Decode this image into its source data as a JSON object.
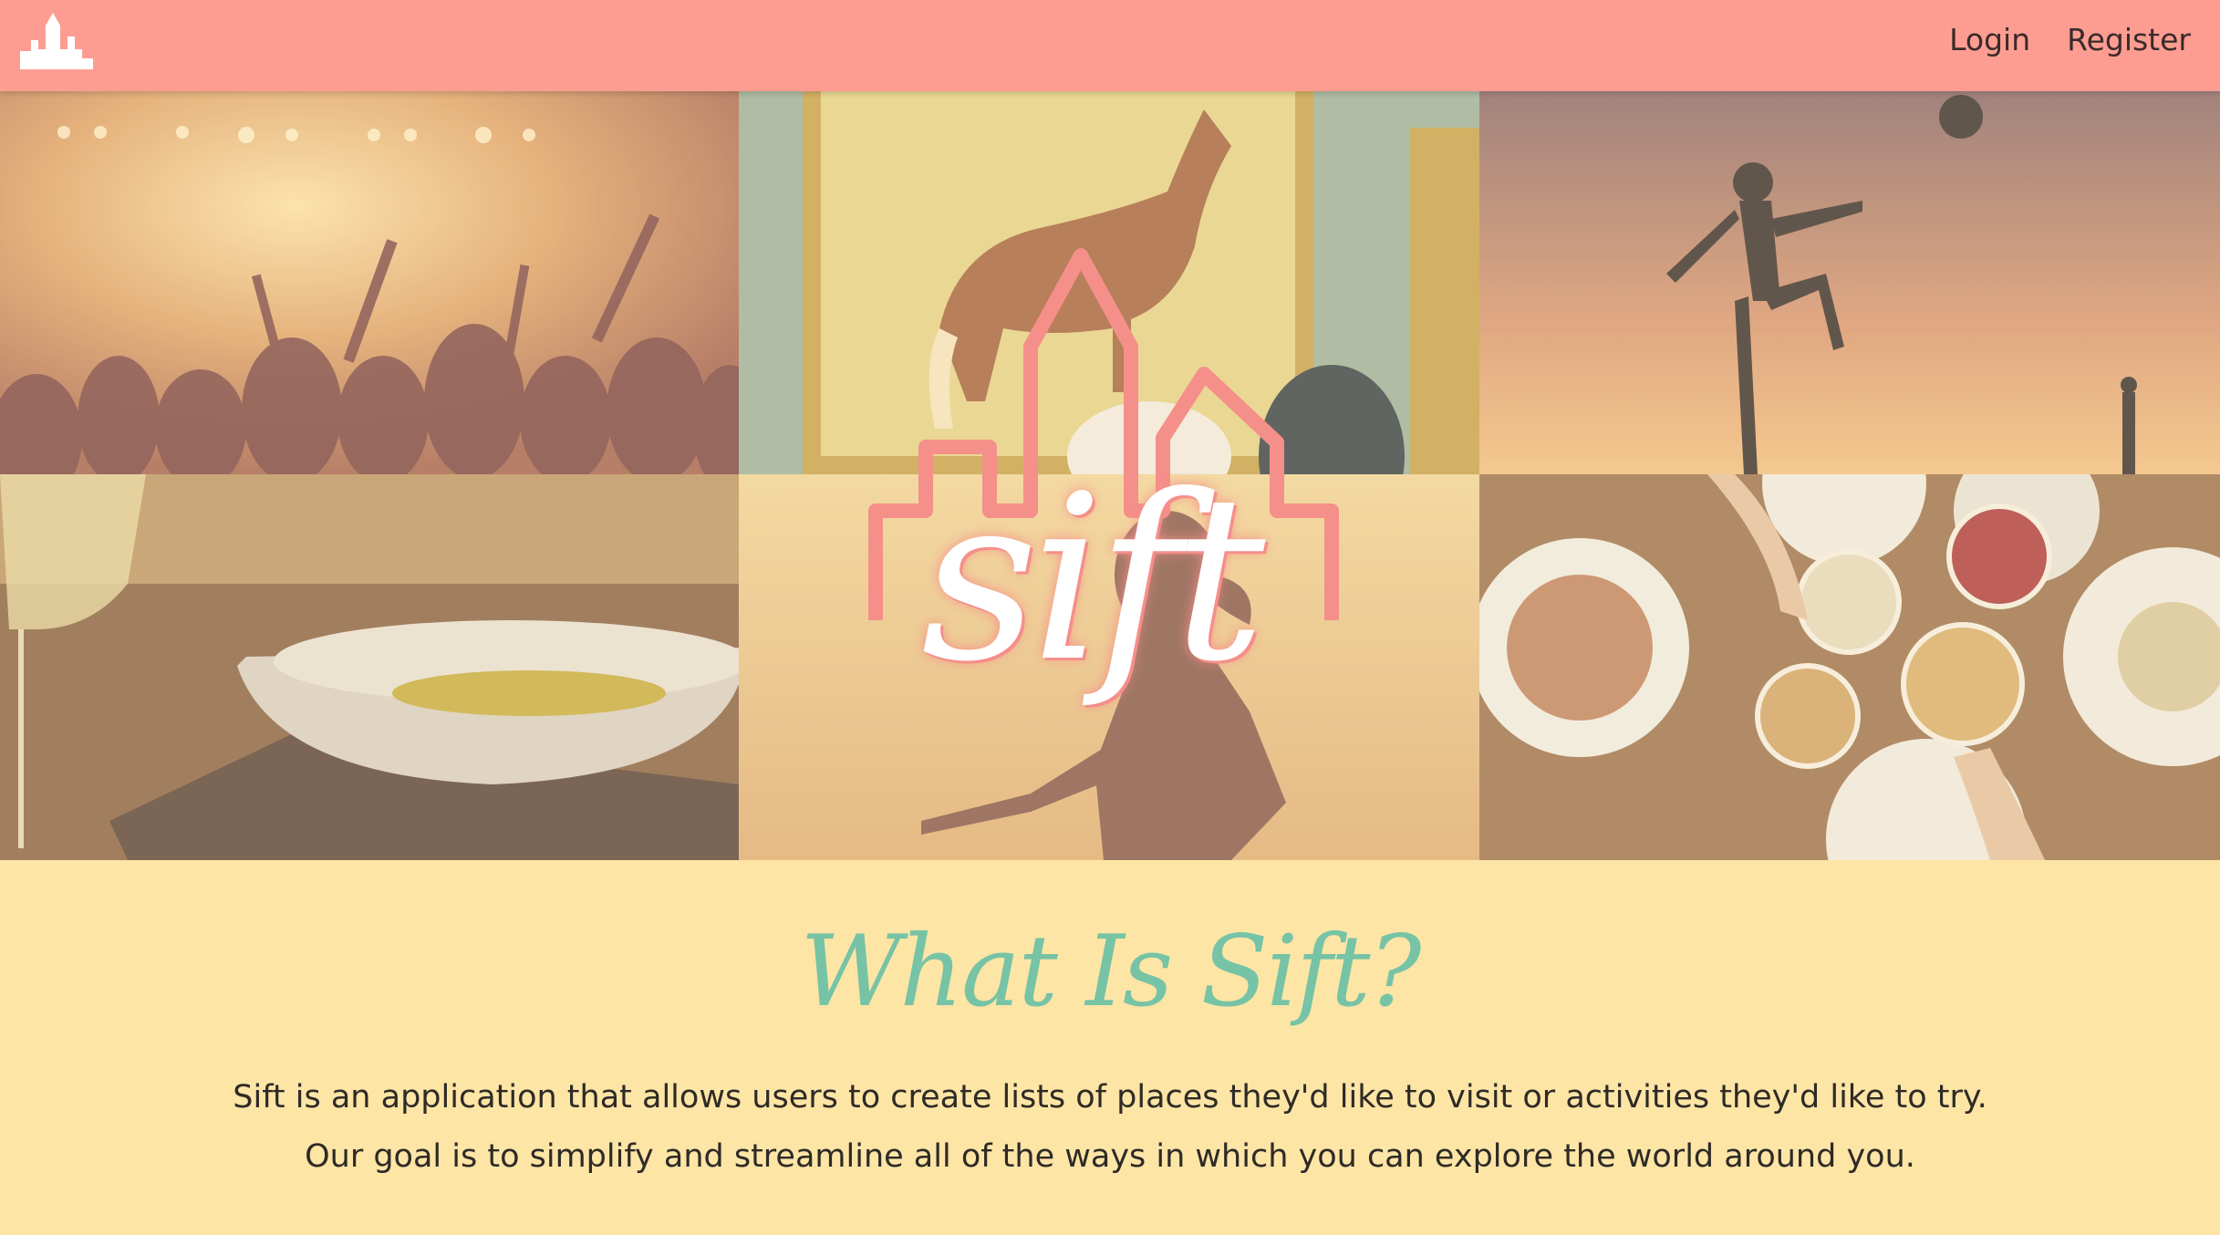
{
  "navbar": {
    "logo_icon": "castle-icon",
    "links": [
      {
        "label": "Login"
      },
      {
        "label": "Register"
      }
    ],
    "background": "#fd9d91"
  },
  "hero": {
    "logo_text": "sift",
    "logo_outline_color": "#f58f8a",
    "images": [
      {
        "subject": "concert crowd"
      },
      {
        "subject": "horse painting in gallery"
      },
      {
        "subject": "silhouette kicking ball at sunset"
      },
      {
        "subject": "restaurant bowl with wine glass"
      },
      {
        "subject": "woman silhouette at sunset"
      },
      {
        "subject": "friends toasting over dinner"
      }
    ]
  },
  "about": {
    "title": "What Is Sift?",
    "line1": "Sift is an application that allows users to create lists of places they'd like to visit or activities they'd like to try.",
    "line2": "Our goal is to simplify and streamline all of the ways in which you can explore the world around you.",
    "title_color": "#76c3a6",
    "background": "#fde5a6"
  }
}
